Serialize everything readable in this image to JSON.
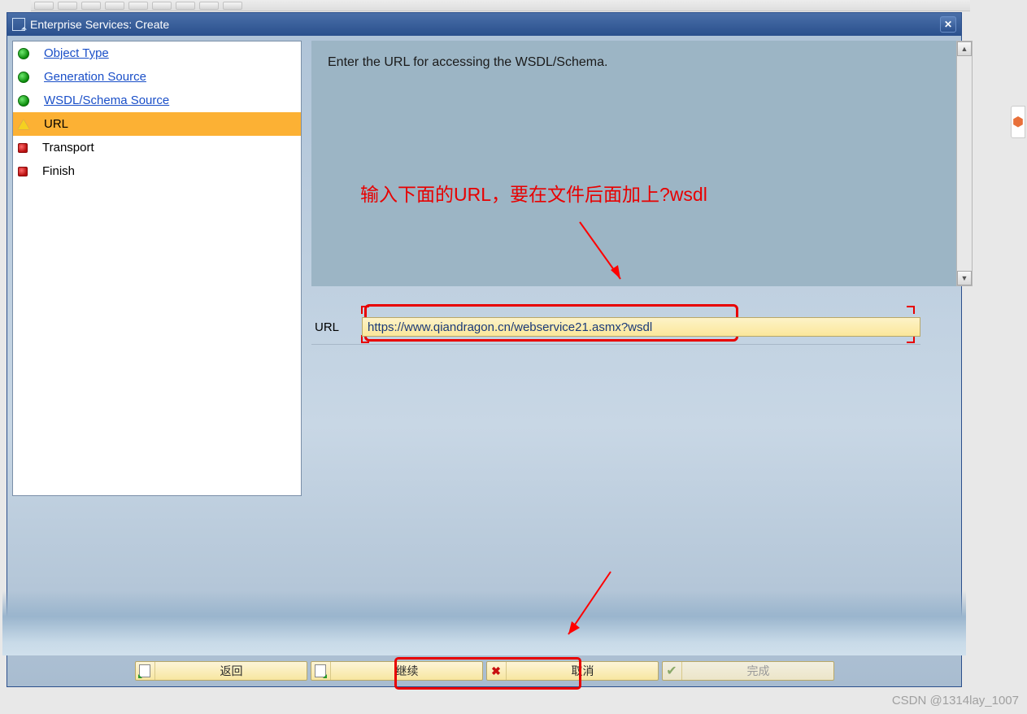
{
  "dialog": {
    "title": "Enterprise Services: Create"
  },
  "sidebar": {
    "items": [
      {
        "label": "Object Type",
        "status": "done",
        "link": true
      },
      {
        "label": "Generation Source",
        "status": "done",
        "link": true
      },
      {
        "label": "WSDL/Schema Source",
        "status": "done",
        "link": true
      },
      {
        "label": "URL",
        "status": "current",
        "link": false
      },
      {
        "label": "Transport",
        "status": "pending",
        "link": false
      },
      {
        "label": "Finish",
        "status": "pending",
        "link": false
      }
    ]
  },
  "content": {
    "instruction": "Enter the URL for accessing the WSDL/Schema.",
    "url_label": "URL",
    "url_value": "https://www.qiandragon.cn/webservice21.asmx?wsdl"
  },
  "annotation": {
    "text": "输入下面的URL，要在文件后面加上?wsdl"
  },
  "buttons": {
    "back": "返回",
    "continue": "继续",
    "cancel": "取消",
    "finish": "完成"
  },
  "watermark": "CSDN @1314lay_1007"
}
